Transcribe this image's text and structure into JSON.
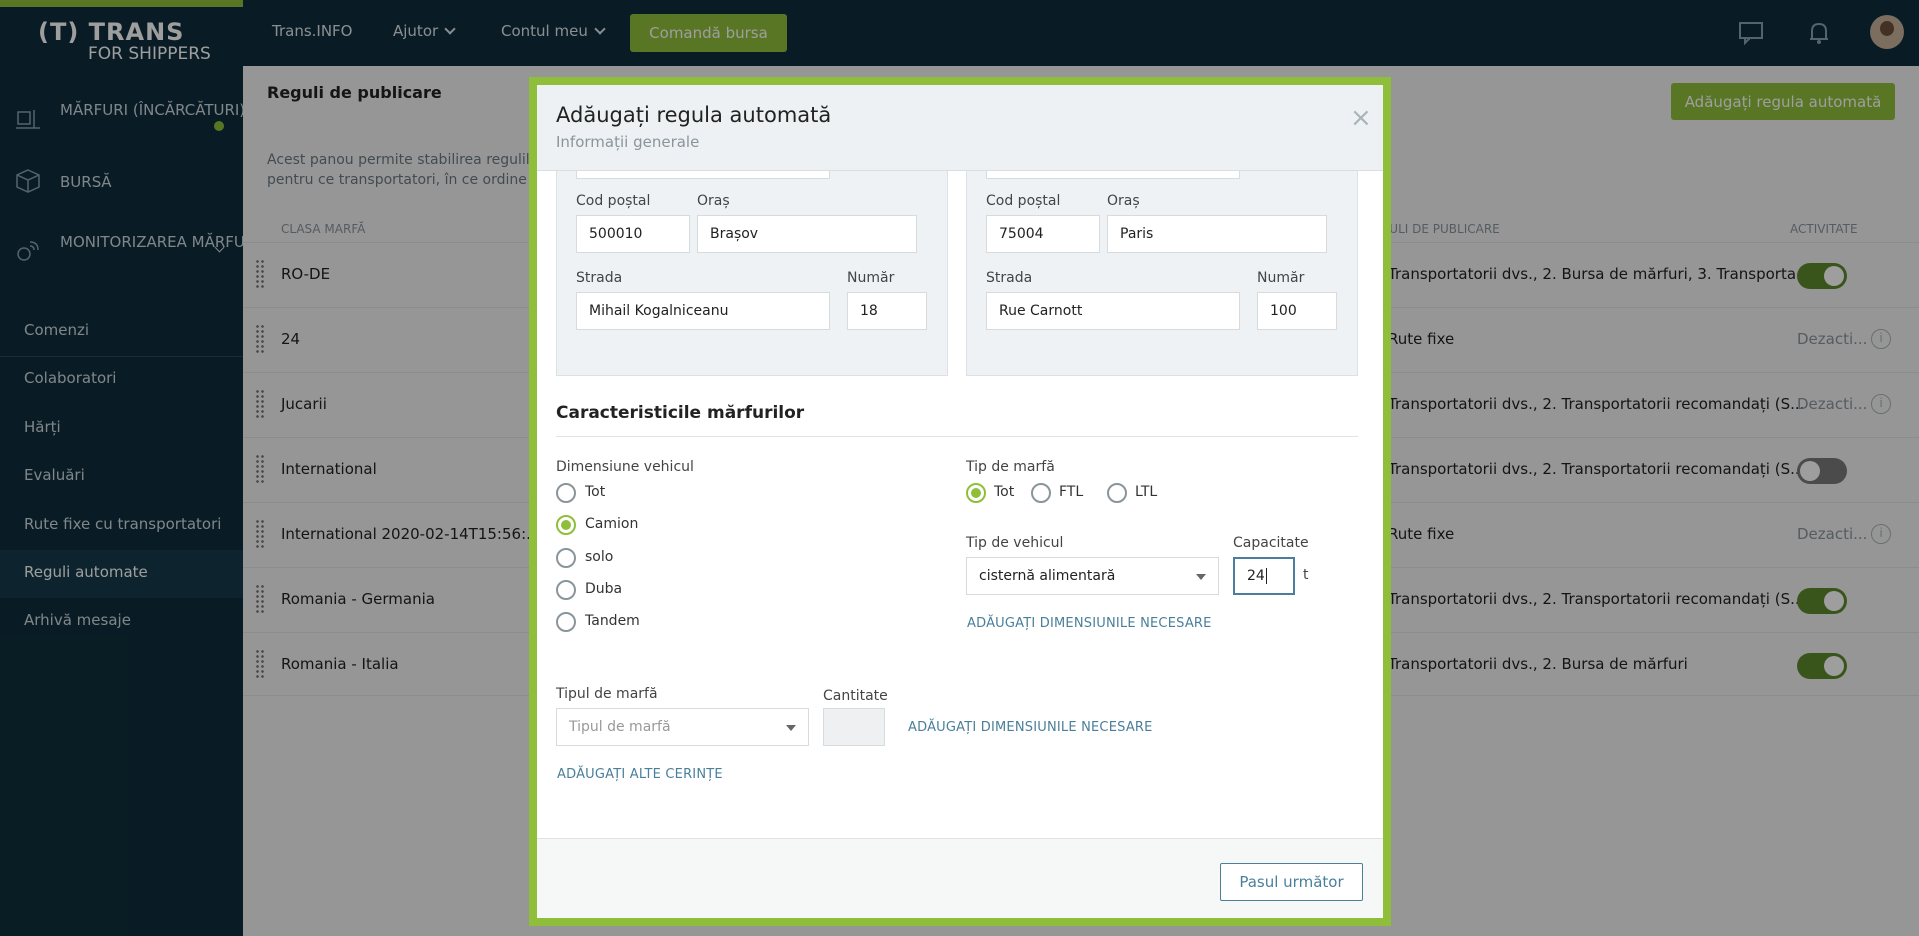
{
  "topbar": {
    "logo_line1": "(T) TRANS",
    "logo_line2": "FOR SHIPPERS",
    "nav": [
      "Trans.INFO",
      "Ajutor",
      "Contul meu"
    ],
    "bursa_button": "Comandă bursa",
    "icons": [
      "chat-icon",
      "bell-icon",
      "avatar"
    ]
  },
  "sidebar": {
    "main": [
      {
        "label": "MĂRFURI (ÎNCĂRCĂTURI)",
        "icon": "cargo-icon",
        "has_dot": true
      },
      {
        "label": "BURSĂ",
        "icon": "box-icon",
        "expandable": true
      },
      {
        "label": "MONITORIZAREA MĂRFURILOR TRIMISE",
        "icon": "satellite-icon"
      }
    ],
    "items": [
      "Comenzi",
      "Colaboratori",
      "Hărți",
      "Evaluări",
      "Rute fixe cu transportatori",
      "Reguli automate",
      "Arhivă mesaje"
    ],
    "active": "Reguli automate"
  },
  "content": {
    "title": "Reguli de publicare",
    "description": "Acest panou permite stabilirea regulilor pentru ce transportatori, în ce ordine și",
    "add_button": "Adăugați regula automată",
    "columns": {
      "class": "CLASA MARFĂ",
      "rules": "GULI DE PUBLICARE",
      "activity": "ACTIVITATE"
    },
    "rows": [
      {
        "name": "RO-DE",
        "rules": "Transportatorii dvs., 2. Bursa de mărfuri, 3. Transporta...",
        "status": "on"
      },
      {
        "name": "24",
        "rules": "Rute fixe",
        "status": "Dezacti..."
      },
      {
        "name": "Jucarii",
        "rules": "Transportatorii dvs., 2. Transportatorii recomandați (S...",
        "status": "Dezacti..."
      },
      {
        "name": "International",
        "rules": "Transportatorii dvs., 2. Transportatorii recomandați (S...",
        "status": "off"
      },
      {
        "name": "International 2020-02-14T15:56:...",
        "rules": "Rute fixe",
        "status": "Dezacti..."
      },
      {
        "name": "Romania - Germania",
        "rules": "Transportatorii dvs., 2. Transportatorii recomandați (S...",
        "status": "on"
      },
      {
        "name": "Romania - Italia",
        "rules": "Transportatorii dvs., 2. Bursa de mărfuri",
        "status": "on"
      }
    ]
  },
  "modal": {
    "title": "Adăugați regula automată",
    "subtitle": "Informații generale",
    "close": "×",
    "origin": {
      "postal_label": "Cod poștal",
      "postal": "500010",
      "city_label": "Oraș",
      "city": "Brașov",
      "street_label": "Strada",
      "street": "Mihail Kogalniceanu",
      "number_label": "Număr",
      "number": "18"
    },
    "destination": {
      "postal_label": "Cod poștal",
      "postal": "75004",
      "city_label": "Oraș",
      "city": "Paris",
      "street_label": "Strada",
      "street": "Rue Carnott",
      "number_label": "Număr",
      "number": "100"
    },
    "section_title": "Caracteristicile mărfurilor",
    "vehicle_size": {
      "label": "Dimensiune vehicul",
      "options": [
        "Tot",
        "Camion",
        "solo",
        "Duba",
        "Tandem"
      ],
      "selected": "Camion"
    },
    "cargo_type": {
      "label": "Tip de marfă",
      "options": [
        "Tot",
        "FTL",
        "LTL"
      ],
      "selected": "Tot"
    },
    "vehicle_type": {
      "label": "Tip de vehicul",
      "value": "cisternă alimentară"
    },
    "capacity": {
      "label": "Capacitate",
      "value": "24",
      "unit": "t"
    },
    "add_dimensions_link": "ADĂUGAȚI DIMENSIUNILE NECESARE",
    "goods_type": {
      "label": "Tipul de marfă",
      "placeholder": "Tipul de marfă"
    },
    "quantity": {
      "label": "Cantitate"
    },
    "add_dimensions_link2": "ADĂUGAȚI DIMENSIUNILE NECESARE",
    "add_requirements_link": "ADĂUGAȚI ALTE CERINȚE",
    "next_button": "Pasul următor"
  }
}
